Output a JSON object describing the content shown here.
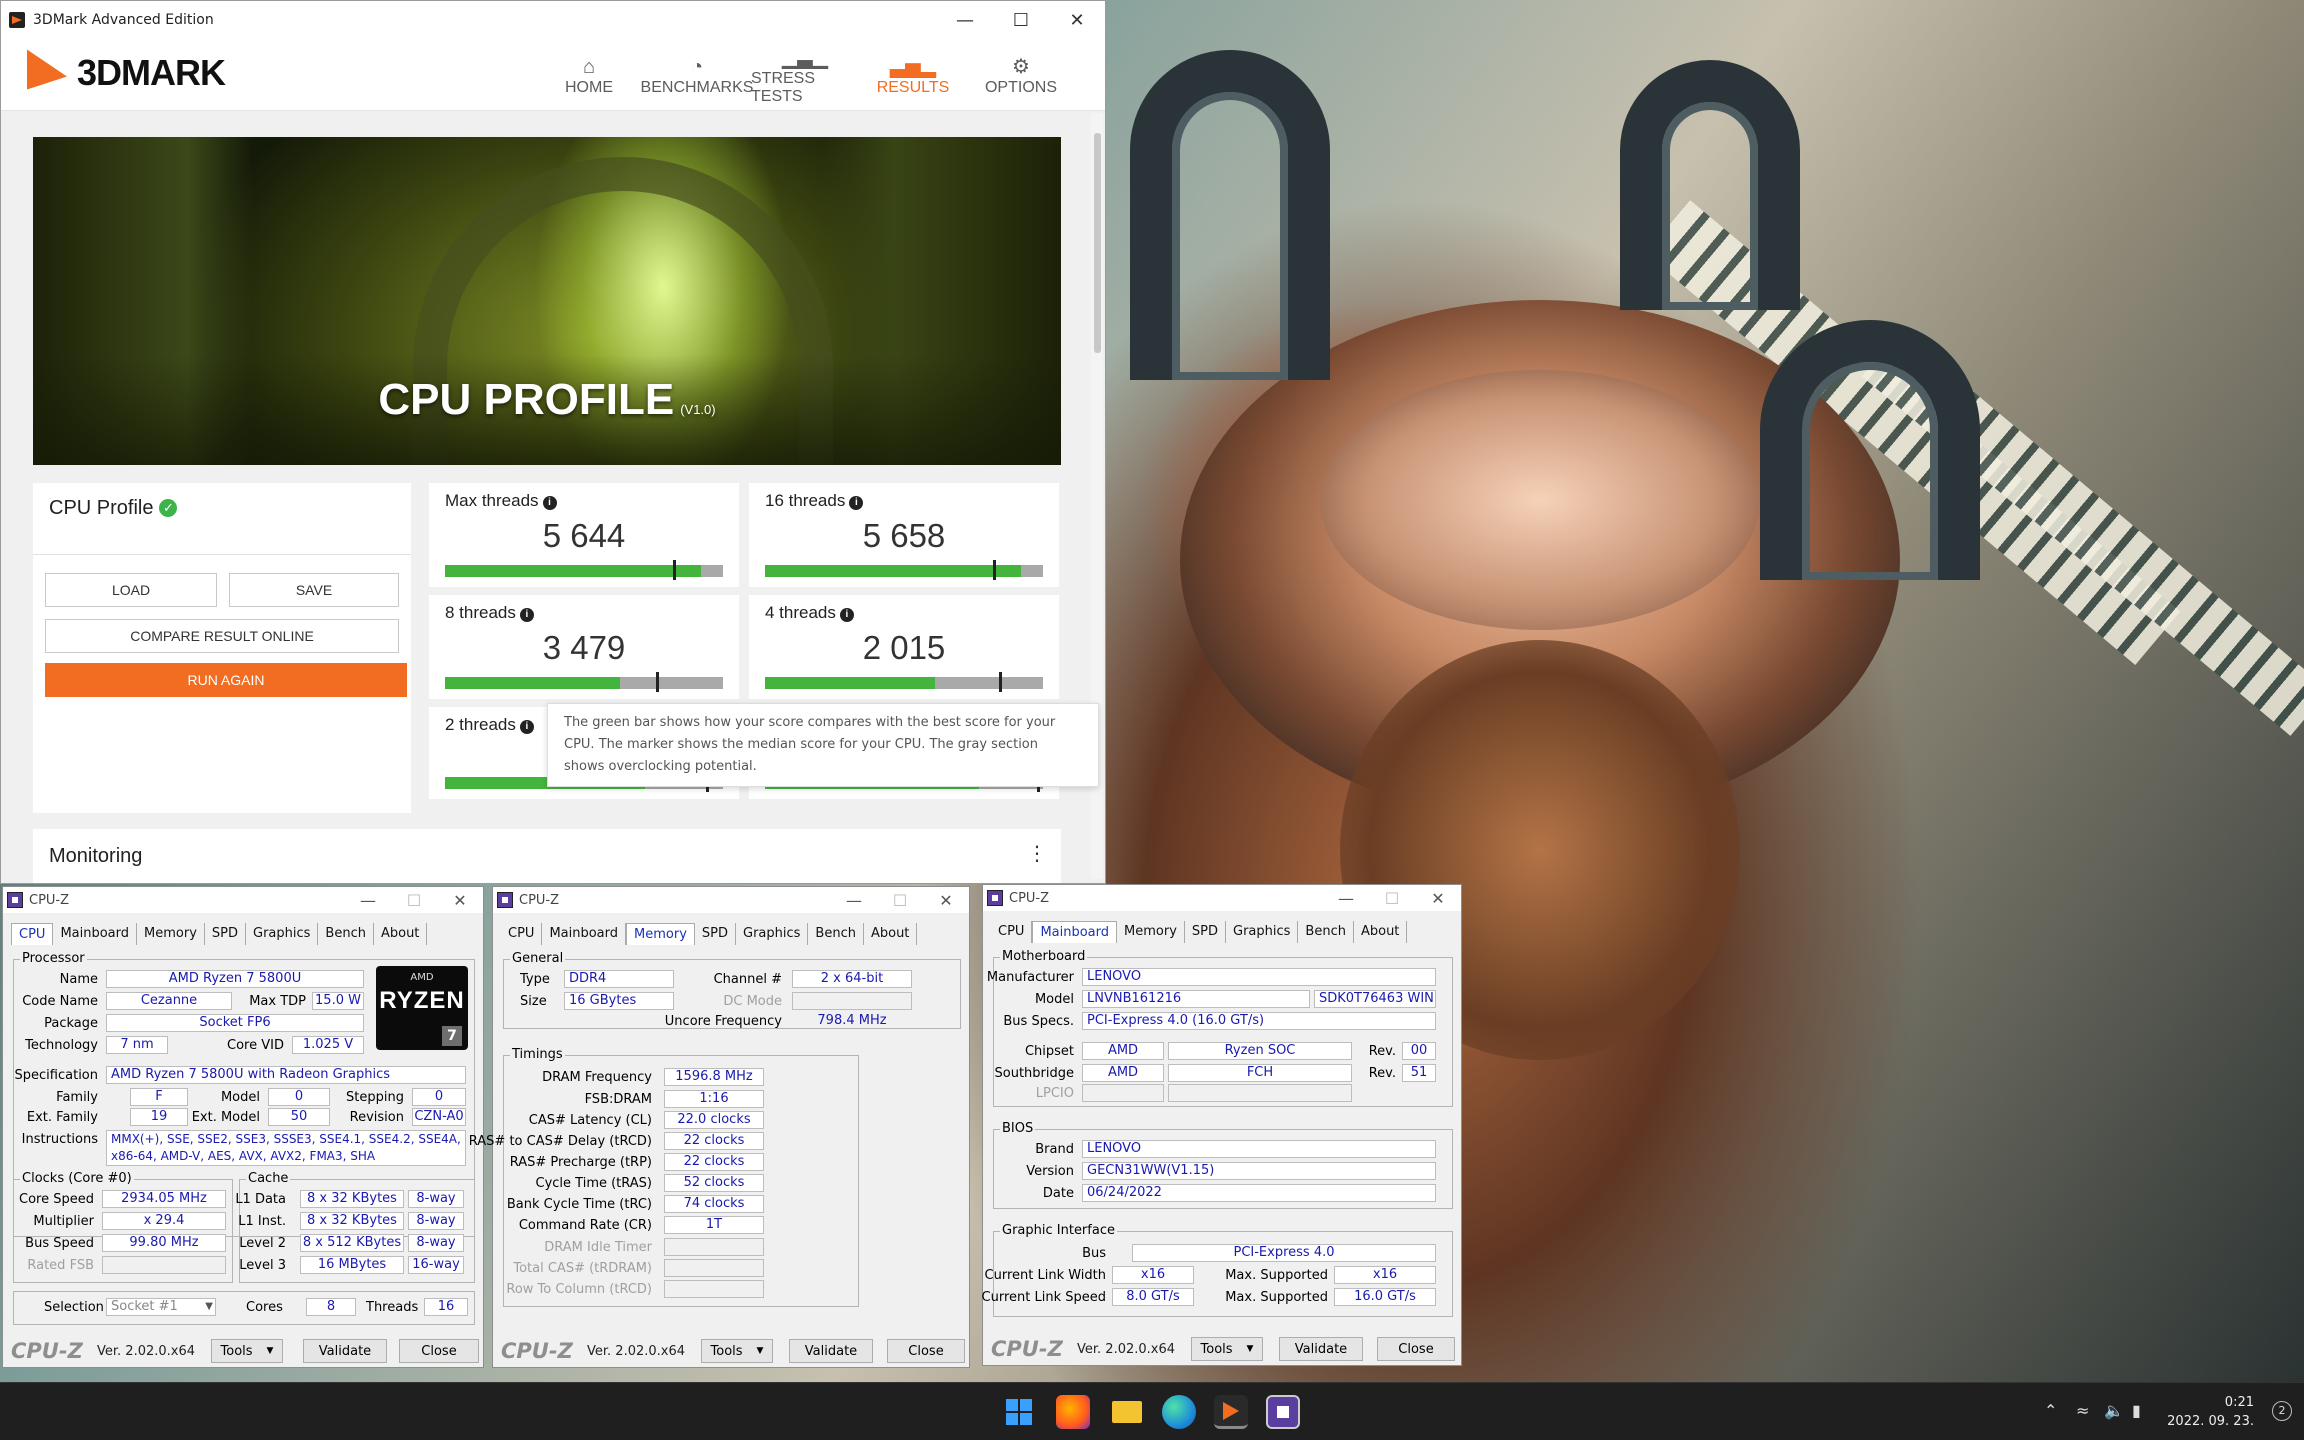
{
  "tdmark": {
    "window_title": "3DMark Advanced Edition",
    "logo_text": "3DMARK",
    "nav": [
      {
        "label": "HOME",
        "icon": "home-icon"
      },
      {
        "label": "BENCHMARKS",
        "icon": "gauge-icon"
      },
      {
        "label": "STRESS TESTS",
        "icon": "bars-icon"
      },
      {
        "label": "RESULTS",
        "icon": "results-chart-icon",
        "active": true
      },
      {
        "label": "OPTIONS",
        "icon": "gear-icon"
      }
    ],
    "banner_title": "CPU PROFILE",
    "banner_version": "(V1.0)",
    "profile_title": "CPU Profile",
    "buttons": {
      "load": "LOAD",
      "save": "SAVE",
      "compare": "COMPARE RESULT ONLINE",
      "run_again": "RUN AGAIN"
    },
    "scores": [
      {
        "label": "Max threads",
        "value": "5 644",
        "bar_fraction": 0.92,
        "marker_fraction": 0.82
      },
      {
        "label": "16 threads",
        "value": "5 658",
        "bar_fraction": 0.92,
        "marker_fraction": 0.82
      },
      {
        "label": "8 threads",
        "value": "3 479",
        "bar_fraction": 0.63,
        "marker_fraction": 0.76
      },
      {
        "label": "4 threads",
        "value": "2 015",
        "bar_fraction": 0.61,
        "marker_fraction": 0.84
      },
      {
        "label": "2 threads",
        "value": "",
        "bar_fraction": 0.72,
        "marker_fraction": 0.94
      },
      {
        "label": "",
        "value": "",
        "bar_fraction": 0.77,
        "marker_fraction": 0.98
      }
    ],
    "tooltip": "The green bar shows how your score compares with the best score for your CPU. The marker shows the median score for your CPU. The gray section shows overclocking potential.",
    "monitoring_title": "Monitoring",
    "accent_color": "#f26d21",
    "bar_green": "#43b53d"
  },
  "cpuz_common": {
    "title": "CPU-Z",
    "tabs": [
      "CPU",
      "Mainboard",
      "Memory",
      "SPD",
      "Graphics",
      "Bench",
      "About"
    ],
    "brand": "CPU-Z",
    "version": "Ver. 2.02.0.x64",
    "tools": "Tools",
    "validate": "Validate",
    "close": "Close"
  },
  "cpuz_cpu": {
    "processor_group": "Processor",
    "name_label": "Name",
    "name": "AMD Ryzen 7 5800U",
    "codename_label": "Code Name",
    "codename": "Cezanne",
    "maxtdp_label": "Max TDP",
    "maxtdp": "15.0 W",
    "package_label": "Package",
    "package": "Socket FP6",
    "technology_label": "Technology",
    "technology": "7 nm",
    "corevid_label": "Core VID",
    "corevid": "1.025 V",
    "spec_label": "Specification",
    "spec": "AMD Ryzen 7 5800U with Radeon Graphics",
    "family_label": "Family",
    "family": "F",
    "model_label": "Model",
    "model": "0",
    "stepping_label": "Stepping",
    "stepping": "0",
    "extfamily_label": "Ext. Family",
    "extfamily": "19",
    "extmodel_label": "Ext. Model",
    "extmodel": "50",
    "revision_label": "Revision",
    "revision": "CZN-A0",
    "instructions_label": "Instructions",
    "instructions_1": "MMX(+), SSE, SSE2, SSE3, SSSE3, SSE4.1, SSE4.2, SSE4A,",
    "instructions_2": "x86-64, AMD-V, AES, AVX, AVX2, FMA3, SHA",
    "clocks_group": "Clocks (Core #0)",
    "corespeed_label": "Core Speed",
    "corespeed": "2934.05 MHz",
    "multiplier_label": "Multiplier",
    "multiplier": "x 29.4",
    "busspeed_label": "Bus Speed",
    "busspeed": "99.80 MHz",
    "ratedfsb_label": "Rated FSB",
    "cache_group": "Cache",
    "l1data_label": "L1 Data",
    "l1data": "8 x 32 KBytes",
    "l1data_way": "8-way",
    "l1inst_label": "L1 Inst.",
    "l1inst": "8 x 32 KBytes",
    "l1inst_way": "8-way",
    "l2_label": "Level 2",
    "l2": "8 x 512 KBytes",
    "l2_way": "8-way",
    "l3_label": "Level 3",
    "l3": "16 MBytes",
    "l3_way": "16-way",
    "selection_label": "Selection",
    "selection": "Socket #1",
    "cores_label": "Cores",
    "cores": "8",
    "threads_label": "Threads",
    "threads": "16",
    "logo_amd": "AMD",
    "logo_ryzen": "RYZEN",
    "logo_num": "7"
  },
  "cpuz_mem": {
    "general_group": "General",
    "type_label": "Type",
    "type": "DDR4",
    "size_label": "Size",
    "size": "16 GBytes",
    "channel_label": "Channel #",
    "channel": "2 x 64-bit",
    "dcmode_label": "DC Mode",
    "uncore_label": "Uncore Frequency",
    "uncore": "798.4 MHz",
    "timings_group": "Timings",
    "dram_freq_label": "DRAM Frequency",
    "dram_freq": "1596.8 MHz",
    "fsb_dram_label": "FSB:DRAM",
    "fsb_dram": "1:16",
    "cl_label": "CAS# Latency (CL)",
    "cl": "22.0 clocks",
    "trcd_label": "RAS# to CAS# Delay (tRCD)",
    "trcd": "22 clocks",
    "trp_label": "RAS# Precharge (tRP)",
    "trp": "22 clocks",
    "tras_label": "Cycle Time (tRAS)",
    "tras": "52 clocks",
    "trc_label": "Bank Cycle Time (tRC)",
    "trc": "74 clocks",
    "cr_label": "Command Rate (CR)",
    "cr": "1T",
    "idle_label": "DRAM Idle Timer",
    "trdram_label": "Total CAS# (tRDRAM)",
    "trcd2_label": "Row To Column (tRCD)"
  },
  "cpuz_mb": {
    "mb_group": "Motherboard",
    "manufacturer_label": "Manufacturer",
    "manufacturer": "LENOVO",
    "model_label": "Model",
    "model": "LNVNB161216",
    "model2": "SDK0T76463 WIN",
    "busspecs_label": "Bus Specs.",
    "busspecs": "PCI-Express 4.0 (16.0 GT/s)",
    "chipset_label": "Chipset",
    "chipset_vendor": "AMD",
    "chipset_name": "Ryzen SOC",
    "rev_label": "Rev.",
    "chipset_rev": "00",
    "southbridge_label": "Southbridge",
    "sb_vendor": "AMD",
    "sb_name": "FCH",
    "sb_rev": "51",
    "lpcio_label": "LPCIO",
    "bios_group": "BIOS",
    "brand_label": "Brand",
    "brand": "LENOVO",
    "version_label": "Version",
    "version": "GECN31WW(V1.15)",
    "date_label": "Date",
    "date": "06/24/2022",
    "gi_group": "Graphic Interface",
    "bus_label": "Bus",
    "bus": "PCI-Express 4.0",
    "clw_label": "Current Link Width",
    "clw": "x16",
    "maxs_label": "Max. Supported",
    "maxw": "x16",
    "cls_label": "Current Link Speed",
    "cls": "8.0 GT/s",
    "maxsp": "16.0 GT/s"
  },
  "taskbar": {
    "time": "0:21",
    "date": "2022. 09. 23.",
    "notifications": "2",
    "apps": [
      "start-icon",
      "firefox-icon",
      "file-explorer-icon",
      "edge-icon",
      "3dmark-taskbar-icon",
      "cpuz-taskbar-icon"
    ]
  }
}
